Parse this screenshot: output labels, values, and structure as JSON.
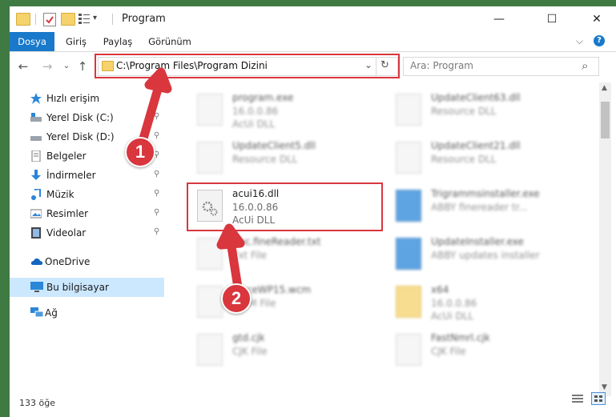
{
  "window": {
    "title": "Program",
    "min": "—",
    "max": "☐",
    "close": "✕"
  },
  "ribbon": {
    "tabs": [
      "Dosya",
      "Giriş",
      "Paylaş",
      "Görünüm"
    ],
    "chevron": "⌵",
    "help": "?"
  },
  "nav": {
    "back": "←",
    "forward": "→",
    "recent": "⌄",
    "up": "↑"
  },
  "address": {
    "path": "C:\\Program Files\\Program Dizini",
    "dropdown": "⌄",
    "refresh": "↻"
  },
  "search": {
    "placeholder": "Ara: Program",
    "icon": "⌕"
  },
  "sidebar": {
    "items": [
      {
        "label": "Hızlı erişim",
        "icon": "star-icon",
        "pinned": false
      },
      {
        "label": "Yerel Disk (C:)",
        "icon": "drive-icon",
        "pinned": true
      },
      {
        "label": "Yerel Disk (D:)",
        "icon": "drive-icon",
        "pinned": true
      },
      {
        "label": "Belgeler",
        "icon": "documents-icon",
        "pinned": true
      },
      {
        "label": "İndirmeler",
        "icon": "download-icon",
        "pinned": true
      },
      {
        "label": "Müzik",
        "icon": "music-icon",
        "pinned": true
      },
      {
        "label": "Resimler",
        "icon": "pictures-icon",
        "pinned": true
      },
      {
        "label": "Videolar",
        "icon": "videos-icon",
        "pinned": true
      },
      {
        "label": "OneDrive",
        "icon": "cloud-icon",
        "pinned": false
      },
      {
        "label": "Bu bilgisayar",
        "icon": "computer-icon",
        "pinned": false
      },
      {
        "label": "Ağ",
        "icon": "network-icon",
        "pinned": false
      }
    ],
    "pin_glyph": "📌"
  },
  "files": {
    "left": [
      {
        "name": "program.exe",
        "sub1": "16.0.0.86",
        "sub2": "AcUi DLL"
      },
      {
        "name": "UpdateClient5.dll",
        "sub1": "Resource DLL",
        "sub2": ""
      },
      {
        "name": "acui16.dll",
        "sub1": "16.0.0.86",
        "sub2": "AcUi DLL"
      },
      {
        "name": "Abc.fineReader.txt",
        "sub1": "Txt File",
        "sub2": ""
      },
      {
        "name": "TraceWP15.wcm",
        "sub1": "WCM File",
        "sub2": ""
      },
      {
        "name": "gtd.cjk",
        "sub1": "CJK File",
        "sub2": ""
      }
    ],
    "right": [
      {
        "name": "UpdateClient63.dll",
        "sub1": "Resource DLL",
        "sub2": ""
      },
      {
        "name": "UpdateClient21.dll",
        "sub1": "Resource DLL",
        "sub2": ""
      },
      {
        "name": "Trigrammsinstaller.exe",
        "sub1": "ABBY finereader tr...",
        "sub2": ""
      },
      {
        "name": "UpdateInstaller.exe",
        "sub1": "ABBY updates installer",
        "sub2": ""
      },
      {
        "name": "x64",
        "sub1": "16.0.0.86",
        "sub2": "AcUi DLL"
      },
      {
        "name": "FastNmrl.cjk",
        "sub1": "CJK File",
        "sub2": ""
      }
    ]
  },
  "annotations": {
    "step1": "1",
    "step2": "2"
  },
  "status": {
    "count": "133 öğe"
  },
  "colors": {
    "accent": "#1979ca",
    "highlight": "#d9363e",
    "selected": "#cce8ff"
  }
}
